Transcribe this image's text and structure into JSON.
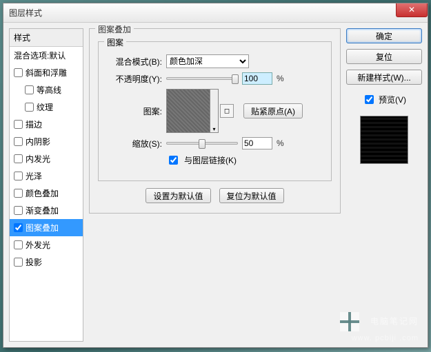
{
  "window": {
    "title": "图层样式"
  },
  "styles_panel": {
    "header": "样式",
    "blend_options": "混合选项:默认",
    "items": [
      {
        "label": "斜面和浮雕",
        "checked": false,
        "indent": false
      },
      {
        "label": "等高线",
        "checked": false,
        "indent": true
      },
      {
        "label": "纹理",
        "checked": false,
        "indent": true
      },
      {
        "label": "描边",
        "checked": false,
        "indent": false
      },
      {
        "label": "内阴影",
        "checked": false,
        "indent": false
      },
      {
        "label": "内发光",
        "checked": false,
        "indent": false
      },
      {
        "label": "光泽",
        "checked": false,
        "indent": false
      },
      {
        "label": "颜色叠加",
        "checked": false,
        "indent": false
      },
      {
        "label": "渐变叠加",
        "checked": false,
        "indent": false
      },
      {
        "label": "图案叠加",
        "checked": true,
        "indent": false,
        "selected": true
      },
      {
        "label": "外发光",
        "checked": false,
        "indent": false
      },
      {
        "label": "投影",
        "checked": false,
        "indent": false
      }
    ]
  },
  "overlay": {
    "group_title": "图案叠加",
    "pattern_group": "图案",
    "blend_mode_label": "混合模式(B):",
    "blend_mode_value": "颜色加深",
    "opacity_label": "不透明度(Y):",
    "opacity_value": "100",
    "pattern_label": "图案:",
    "snap_origin": "贴紧原点(A)",
    "scale_label": "缩放(S):",
    "scale_value": "50",
    "link_label": "与图层链接(K)",
    "pct": "%",
    "set_default": "设置为默认值",
    "reset_default": "复位为默认值"
  },
  "right": {
    "ok": "确定",
    "reset": "复位",
    "new_style": "新建样式(W)...",
    "preview": "预览(V)"
  },
  "watermark": {
    "line1": "电脑笔记网",
    "line2": "www. pcbiji .com"
  }
}
